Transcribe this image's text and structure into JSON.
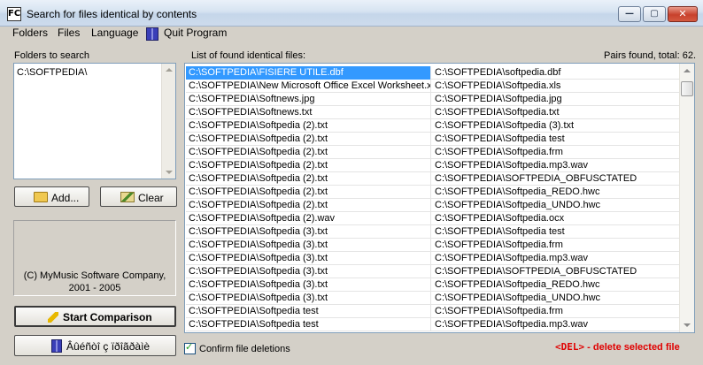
{
  "window": {
    "title": "Search for files identical by contents",
    "icon_text": "FC",
    "controls": {
      "minimize": "—",
      "maximize": "▢",
      "close": "✕"
    }
  },
  "menu": {
    "folders": "Folders",
    "files": "Files",
    "language": "Language",
    "quit": "Quit Program"
  },
  "left": {
    "folders_label": "Folders to search",
    "folders": [
      "C:\\SOFTPEDIA\\"
    ],
    "add_button": "Add...",
    "clear_button": "Clear",
    "about_line1": "(C) MyMusic Software Company,",
    "about_line2": "2001 - 2005",
    "start_button": "Start Comparison",
    "bottom_button": "Âûéñòî ç ïðîãðàìè"
  },
  "right": {
    "list_label": "List of found identical files:",
    "pairs_found": "Pairs found, total: 62.",
    "rows": [
      [
        "C:\\SOFTPEDIA\\FISIERE UTILE.dbf",
        "C:\\SOFTPEDIA\\softpedia.dbf"
      ],
      [
        "C:\\SOFTPEDIA\\New Microsoft Office Excel Worksheet.xls",
        "C:\\SOFTPEDIA\\Softpedia.xls"
      ],
      [
        "C:\\SOFTPEDIA\\Softnews.jpg",
        "C:\\SOFTPEDIA\\Softpedia.jpg"
      ],
      [
        "C:\\SOFTPEDIA\\Softnews.txt",
        "C:\\SOFTPEDIA\\Softpedia.txt"
      ],
      [
        "C:\\SOFTPEDIA\\Softpedia (2).txt",
        "C:\\SOFTPEDIA\\Softpedia (3).txt"
      ],
      [
        "C:\\SOFTPEDIA\\Softpedia (2).txt",
        "C:\\SOFTPEDIA\\Softpedia test"
      ],
      [
        "C:\\SOFTPEDIA\\Softpedia (2).txt",
        "C:\\SOFTPEDIA\\Softpedia.frm"
      ],
      [
        "C:\\SOFTPEDIA\\Softpedia (2).txt",
        "C:\\SOFTPEDIA\\Softpedia.mp3.wav"
      ],
      [
        "C:\\SOFTPEDIA\\Softpedia (2).txt",
        "C:\\SOFTPEDIA\\SOFTPEDIA_OBFUSCTATED"
      ],
      [
        "C:\\SOFTPEDIA\\Softpedia (2).txt",
        "C:\\SOFTPEDIA\\Softpedia_REDO.hwc"
      ],
      [
        "C:\\SOFTPEDIA\\Softpedia (2).txt",
        "C:\\SOFTPEDIA\\Softpedia_UNDO.hwc"
      ],
      [
        "C:\\SOFTPEDIA\\Softpedia (2).wav",
        "C:\\SOFTPEDIA\\Softpedia.ocx"
      ],
      [
        "C:\\SOFTPEDIA\\Softpedia (3).txt",
        "C:\\SOFTPEDIA\\Softpedia test"
      ],
      [
        "C:\\SOFTPEDIA\\Softpedia (3).txt",
        "C:\\SOFTPEDIA\\Softpedia.frm"
      ],
      [
        "C:\\SOFTPEDIA\\Softpedia (3).txt",
        "C:\\SOFTPEDIA\\Softpedia.mp3.wav"
      ],
      [
        "C:\\SOFTPEDIA\\Softpedia (3).txt",
        "C:\\SOFTPEDIA\\SOFTPEDIA_OBFUSCTATED"
      ],
      [
        "C:\\SOFTPEDIA\\Softpedia (3).txt",
        "C:\\SOFTPEDIA\\Softpedia_REDO.hwc"
      ],
      [
        "C:\\SOFTPEDIA\\Softpedia (3).txt",
        "C:\\SOFTPEDIA\\Softpedia_UNDO.hwc"
      ],
      [
        "C:\\SOFTPEDIA\\Softpedia test",
        "C:\\SOFTPEDIA\\Softpedia.frm"
      ],
      [
        "C:\\SOFTPEDIA\\Softpedia test",
        "C:\\SOFTPEDIA\\Softpedia.mp3.wav"
      ]
    ],
    "selected_row": 0,
    "confirm_label": "Confirm file deletions",
    "confirm_checked": true,
    "del_key": "<DEL>",
    "del_hint": " - delete selected file"
  }
}
